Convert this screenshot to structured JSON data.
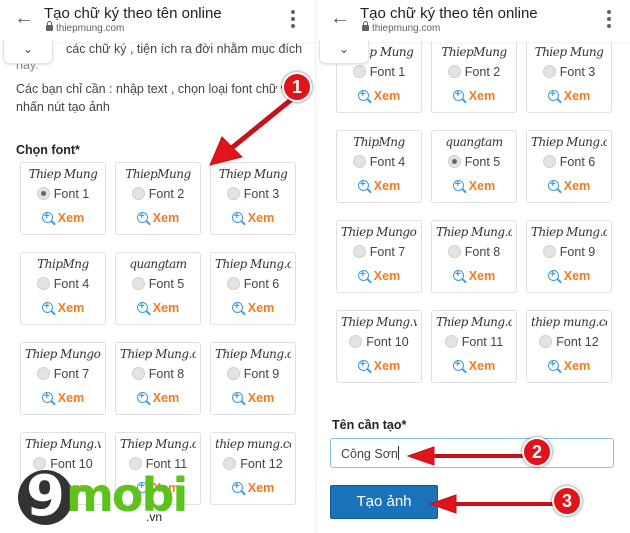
{
  "browser": {
    "title": "Tạo chữ ký theo tên online",
    "url": "thiepmung.com",
    "back_icon": "←",
    "collapse_icon": "⌄"
  },
  "left": {
    "intro_partial_line1": "các chữ  ký , tiện ích ra đời nhằm mục đích",
    "intro_partial_line2": "này.",
    "intro_text": "Các bạn chỉ cần : nhập text , chọn loại font chữ và nhấn nút tạo ảnh",
    "choose_font_label": "Chọn font*",
    "selected_font": "Font 1"
  },
  "right": {
    "selected_font": "Font 5",
    "name_label": "Tên cần tạo*",
    "name_value": "Công Sơn",
    "create_button": "Tạo ảnh"
  },
  "fonts": [
    {
      "label": "Font 1",
      "sample": "Thiep Mung",
      "view": "Xem"
    },
    {
      "label": "Font 2",
      "sample": "ThiepMung",
      "view": "Xem"
    },
    {
      "label": "Font 3",
      "sample": "Thiep Mung",
      "view": "Xem"
    },
    {
      "label": "Font 4",
      "sample": "ThipMng",
      "view": "Xem"
    },
    {
      "label": "Font 5",
      "sample": "quangtam",
      "view": "Xem"
    },
    {
      "label": "Font 6",
      "sample": "Thiep Mung.com",
      "view": "Xem"
    },
    {
      "label": "Font 7",
      "sample": "Thiep Mungon",
      "view": "Xem"
    },
    {
      "label": "Font 8",
      "sample": "Thiep Mung.com",
      "view": "Xem"
    },
    {
      "label": "Font 9",
      "sample": "Thiep Mung.com",
      "view": "Xem"
    },
    {
      "label": "Font 10",
      "sample": "Thiep Mung.vn",
      "view": "Xem"
    },
    {
      "label": "Font 11",
      "sample": "Thiep Mung.com",
      "view": "Xem"
    },
    {
      "label": "Font 12",
      "sample": "thiep mung.com",
      "view": "Xem"
    }
  ],
  "annotations": {
    "step1": "1",
    "step2": "2",
    "step3": "3",
    "accent_color": "#e1141c"
  },
  "watermark": {
    "nine": "9",
    "mobi": "mobi",
    "vn": ".vn"
  },
  "colors": {
    "xem": "#f47a20",
    "zoom_icon": "#3b9be0",
    "button": "#1a73b8",
    "logo_green": "#5ec21c"
  }
}
